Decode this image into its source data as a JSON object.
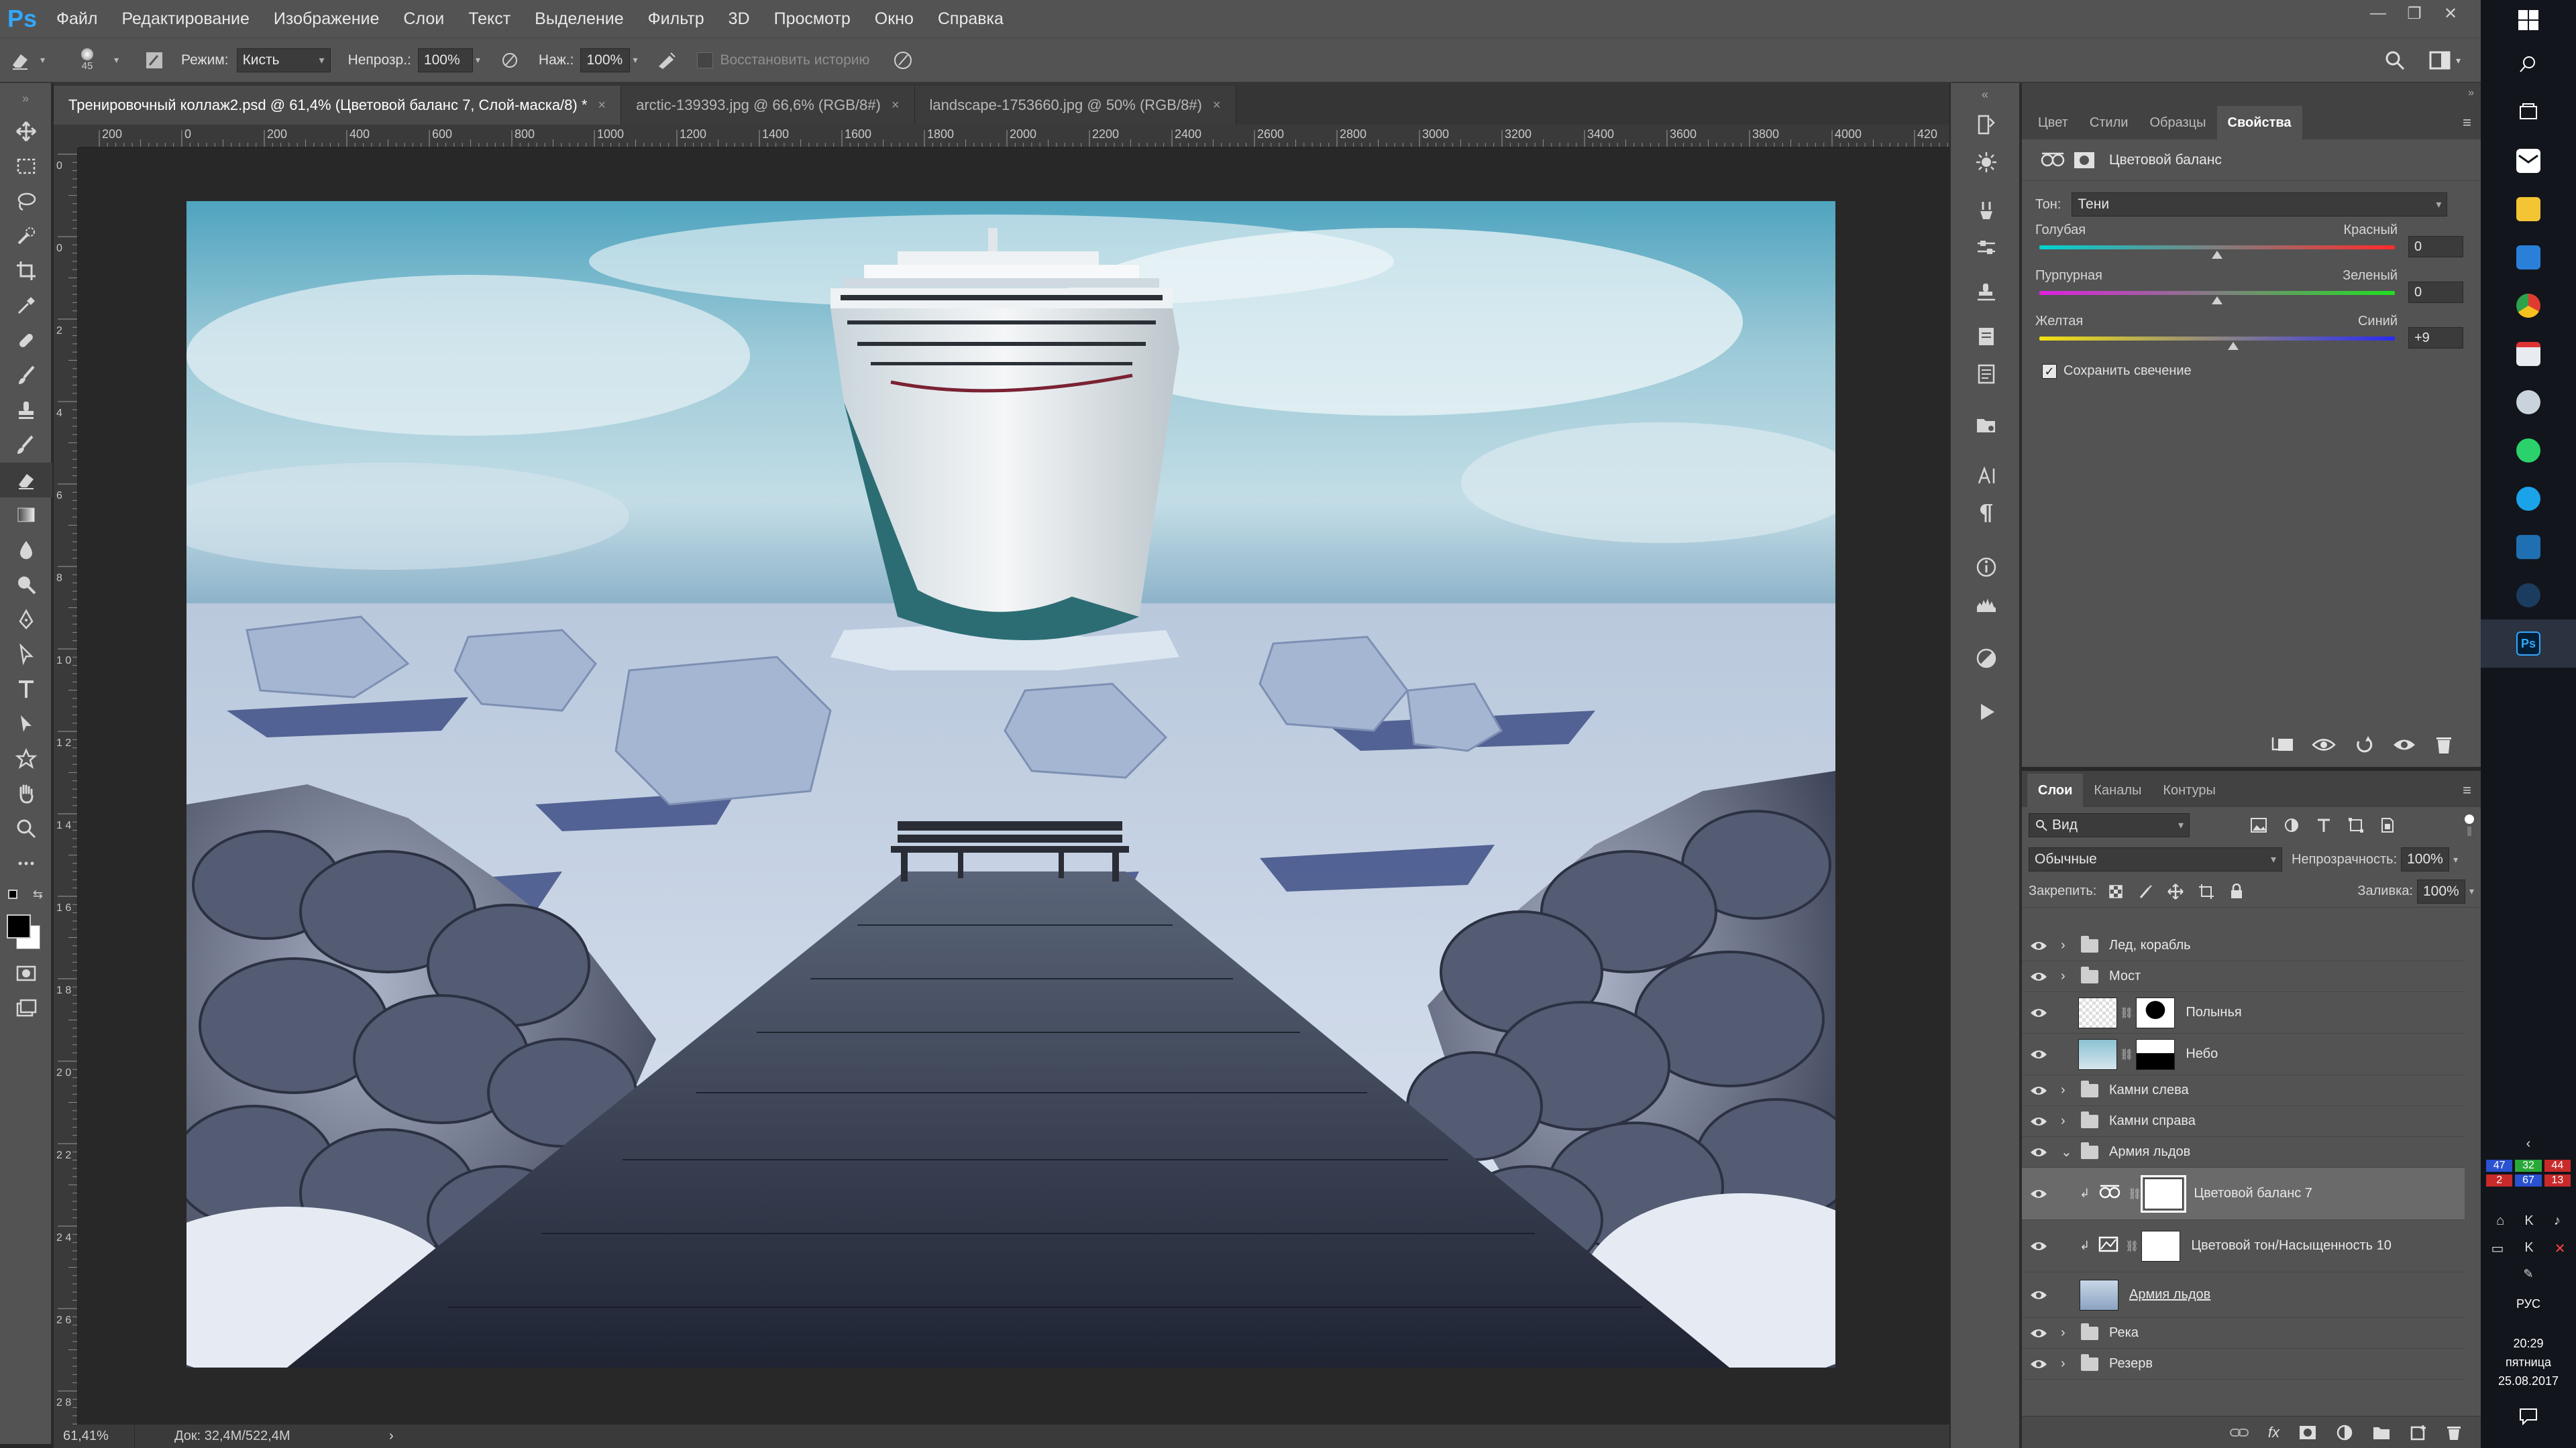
{
  "app": {
    "logo": "Ps"
  },
  "menu": [
    "Файл",
    "Редактирование",
    "Изображение",
    "Слои",
    "Текст",
    "Выделение",
    "Фильтр",
    "3D",
    "Просмотр",
    "Окно",
    "Справка"
  ],
  "options": {
    "brush_size": "45",
    "mode_label": "Режим:",
    "mode_value": "Кисть",
    "opacity_label": "Непрозр.:",
    "opacity_value": "100%",
    "pressure_label": "Наж.:",
    "pressure_value": "100%",
    "restore_history": "Восстановить историю"
  },
  "doc_tabs": [
    {
      "title": "Тренировочный коллаж2.psd @ 61,4% (Цветовой баланс 7, Слой-маска/8) *",
      "close": "×"
    },
    {
      "title": "arctic-139393.jpg @ 66,6% (RGB/8#)",
      "close": "×"
    },
    {
      "title": "landscape-1753660.jpg @ 50% (RGB/8#)",
      "close": "×"
    }
  ],
  "ruler_top": [
    "200",
    "0",
    "200",
    "400",
    "600",
    "800",
    "1000",
    "1200",
    "1400",
    "1600",
    "1800",
    "2000",
    "2200",
    "2400",
    "2600",
    "2800",
    "3000",
    "3200",
    "3400",
    "3600",
    "3800",
    "4000",
    "420"
  ],
  "ruler_left": [
    "0",
    "0",
    "2",
    "4",
    "6",
    "8",
    "1 0",
    "1 2",
    "1 4",
    "1 6",
    "1 8",
    "2 0",
    "2 2",
    "2 4",
    "2 6",
    "2 8"
  ],
  "status": {
    "zoom": "61,41%",
    "doc": "Док: 32,4M/522,4M",
    "arrow": "›"
  },
  "properties": {
    "tabs": [
      "Цвет",
      "Стили",
      "Образцы",
      "Свойства"
    ],
    "active_tab": 3,
    "title": "Цветовой баланс",
    "tone_label": "Тон:",
    "tone_value": "Тени",
    "sliders": [
      {
        "left": "Голубая",
        "right": "Красный",
        "value": "0",
        "pos": 0.5
      },
      {
        "left": "Пурпурная",
        "right": "Зеленый",
        "value": "0",
        "pos": 0.5
      },
      {
        "left": "Желтая",
        "right": "Синий",
        "value": "+9",
        "pos": 0.545
      }
    ],
    "preserve_luminosity": "Сохранить свечение"
  },
  "layers_panel": {
    "tabs": [
      "Слои",
      "Каналы",
      "Контуры"
    ],
    "filter": "Вид",
    "blend_mode": "Обычные",
    "opacity_label": "Непрозрачность:",
    "opacity_value": "100%",
    "lock_label": "Закрепить:",
    "fill_label": "Заливка:",
    "fill_value": "100%",
    "layers": [
      {
        "name": "Лед, корабль",
        "kind": "folder"
      },
      {
        "name": "Мост",
        "kind": "folder"
      },
      {
        "name": "Полынья",
        "kind": "masked"
      },
      {
        "name": "Небо",
        "kind": "masked"
      },
      {
        "name": "Камни слева",
        "kind": "folder"
      },
      {
        "name": "Камни справа",
        "kind": "folder"
      },
      {
        "name": "Армия льдов",
        "kind": "folder-open"
      },
      {
        "name": "Цветовой баланс 7",
        "kind": "adjust"
      },
      {
        "name": "Цветовой тон/Насыщенность 10",
        "kind": "adjust"
      },
      {
        "name": "Армия льдов",
        "kind": "smart"
      },
      {
        "name": "Река",
        "kind": "folder"
      },
      {
        "name": "Резерв",
        "kind": "folder"
      }
    ]
  },
  "taskbar": {
    "tray_numbers": [
      "47",
      "32",
      "44",
      "2",
      "67",
      "13"
    ],
    "lang": "РУС",
    "time": "20:29",
    "weekday": "пятница",
    "date": "25.08.2017",
    "ps_label": "Ps"
  },
  "colors": {
    "panel": "#535353",
    "dark": "#282828",
    "accent": "#31a8ff"
  }
}
